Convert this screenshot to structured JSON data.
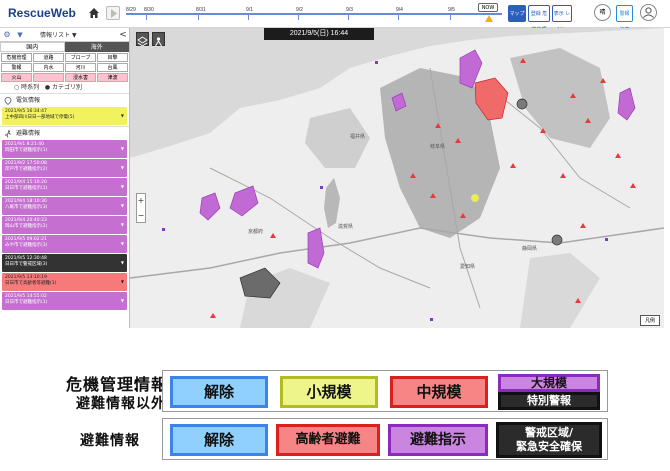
{
  "header": {
    "logo_rescue": "Rescue",
    "logo_web": "Web",
    "timeline_ticks": [
      "8/29",
      "8/30",
      "8/31",
      "9/1",
      "9/2",
      "9/3",
      "9/4",
      "9/5"
    ],
    "now_label": "NOW",
    "buttons": [
      "マップ",
      "登録\n危機管理",
      "表示\nレイヤー"
    ],
    "circle_a": "晴",
    "circle_b": "警報\n注意",
    "colors": {
      "brand": "#1d3f8f",
      "timeline": "#6b8bd1",
      "now": "#f0b400"
    }
  },
  "sidebar": {
    "title": "情報リスト",
    "title_caret": "▼",
    "collapse": "<",
    "tabs": [
      "国内",
      "海外"
    ],
    "active_tab": 1,
    "filters": [
      "危機管理",
      "道路",
      "ブローブ",
      "目撃",
      "警報",
      "内水",
      "河川",
      "台風",
      "火山",
      "",
      "浸水害",
      "",
      "津波",
      ""
    ],
    "radio_options": [
      "○ 時系列",
      "● カテゴリ別"
    ],
    "section_power": "電気情報",
    "power_items": [
      {
        "time": "2021/9/5 16:34:47",
        "text": "上中部四川日日一部地域で停電(5)"
      }
    ],
    "section_evac": "避難情報",
    "evac_items": [
      {
        "time": "2021/9/1 8:21:40",
        "text": "岡田市で避難指示(1)",
        "color": "purple"
      },
      {
        "time": "2021/9/2 17:50:08",
        "text": "岸戸市で避難指示(2)",
        "color": "purple"
      },
      {
        "time": "2021/9/4 15:10:20",
        "text": "日日市で避難指示(1)",
        "color": "purple"
      },
      {
        "time": "2021/9/4 18:10:30",
        "text": "八尾市で避難指示(3)",
        "color": "purple"
      },
      {
        "time": "2021/9/4 20:40:23",
        "text": "岡山市で避難指示(2)",
        "color": "purple"
      },
      {
        "time": "2021/9/5 09:02:21",
        "text": "みや市で避難指示(3)",
        "color": "purple"
      },
      {
        "time": "2021/9/5 12:30:48",
        "text": "日日市で警戒区域(3)",
        "color": "dark"
      },
      {
        "time": "2021/9/5 13:10:19",
        "text": "日日市で高齢者等避難(1)",
        "color": "red"
      },
      {
        "time": "2021/9/5 14:55:02",
        "text": "日日市で避難指示(1)",
        "color": "purple"
      }
    ]
  },
  "map": {
    "datetime": "2021/9/5(日) 16:44",
    "zoom_in": "+",
    "zoom_out": "−",
    "legend_button": "凡例",
    "place_labels": [
      "京都府",
      "滋賀県",
      "福井県",
      "岐阜県",
      "愛知県",
      "静岡県"
    ]
  },
  "legend": {
    "crisis_title": "危機管理情報",
    "colon": "：",
    "crisis_sub": "避難情報以外",
    "evac_title": "避難情報",
    "crisis_boxes": {
      "release": "解除",
      "small": "小規模",
      "medium": "中規模",
      "large": "大規模",
      "special": "特別警報"
    },
    "evac_boxes": {
      "release": "解除",
      "elderly": "高齢者避難",
      "order": "避難指示",
      "emergency_line1": "警戒区域/",
      "emergency_line2": "緊急安全確保"
    },
    "colors": {
      "blue": "#8fd0ff",
      "yellow": "#eef58a",
      "red": "#f78585",
      "purple": "#c985e0",
      "dark": "#2b2b2b"
    }
  }
}
